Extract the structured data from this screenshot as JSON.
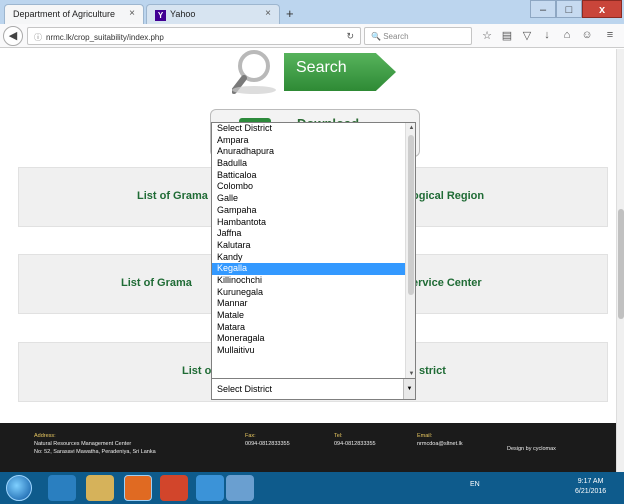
{
  "browser": {
    "tabs": [
      {
        "title": "Department of Agriculture",
        "close": "×"
      },
      {
        "title": "Yahoo",
        "badge": "Y",
        "close": "×"
      }
    ],
    "new_tab": "+",
    "url": "nrmc.lk/crop_suitability/index.php",
    "search_placeholder": "Search",
    "window_buttons": {
      "minimize": "–",
      "maximize": "□",
      "close": "x"
    }
  },
  "page": {
    "search_button": "Search",
    "download_label": "Download",
    "panels": [
      {
        "left_text": "List of Grama",
        "right_text": "ogical Region"
      },
      {
        "left_text": "List of Grama",
        "right_text": "ervice Center"
      },
      {
        "left_text": "List o",
        "right_text": "strict"
      }
    ],
    "district_dropdown": {
      "selected_value": "Select District",
      "highlighted": "Kegalla",
      "options": [
        "Select District",
        "Ampara",
        "Anuradhapura",
        "Badulla",
        "Batticaloa",
        "Colombo",
        "Galle",
        "Gampaha",
        "Hambantota",
        "Jaffna",
        "Kalutara",
        "Kandy",
        "Kegalla",
        "Killinochchi",
        "Kurunegala",
        "Mannar",
        "Matale",
        "Matara",
        "Moneragala",
        "Mullaitivu"
      ]
    },
    "footer": {
      "address_label": "Address:",
      "address_line1": "Natural Resources Management Center",
      "address_line2": "No: 52, Sarasavi Mawatha, Peradeniya, Sri Lanka",
      "fax_label": "Fax:",
      "fax_value": "0094-0812833355",
      "tel_label": "Tel:",
      "tel_value": "094-0812833355",
      "email_label": "Email:",
      "email_value": "nrmcdoa@sltnet.lk",
      "credit": "Design by cyclomax"
    }
  },
  "taskbar": {
    "tray_lang": "EN",
    "time": "9:17 AM",
    "date": "6/21/2016"
  },
  "colors": {
    "accent_green": "#2e8a35",
    "highlight": "#3399ff",
    "footer_bg": "#1b1b1b",
    "taskbar": "#0e5b8c"
  }
}
